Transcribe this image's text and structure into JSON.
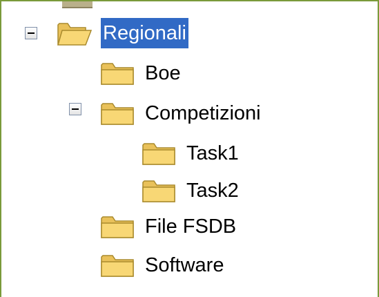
{
  "tree": {
    "root": {
      "label": "Regionali",
      "icon": "folder-open-icon",
      "expanded": true,
      "selected": true
    },
    "boe": {
      "label": "Boe",
      "icon": "folder-icon"
    },
    "competizioni": {
      "label": "Competizioni",
      "icon": "folder-icon",
      "expanded": true
    },
    "task1": {
      "label": "Task1",
      "icon": "folder-icon"
    },
    "task2": {
      "label": "Task2",
      "icon": "folder-icon"
    },
    "file_fsdb": {
      "label": "File FSDB",
      "icon": "folder-icon"
    },
    "software": {
      "label": "Software",
      "icon": "folder-icon"
    }
  },
  "colors": {
    "selection": "#316ac5",
    "frame_border": "#7a9a3a",
    "folder_fill": "#f8d775",
    "folder_stroke": "#a98a2d"
  }
}
